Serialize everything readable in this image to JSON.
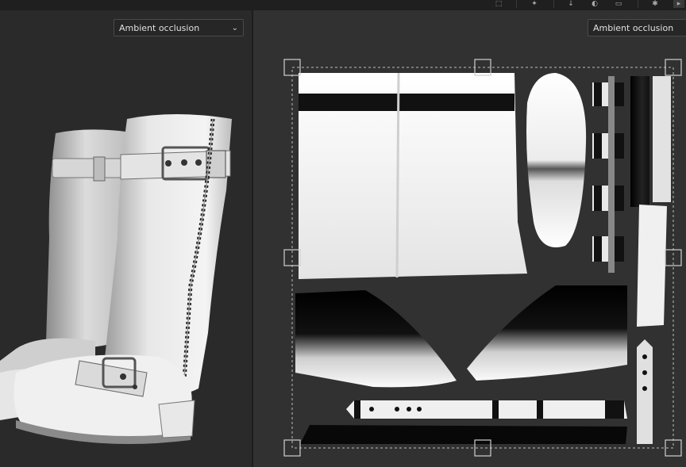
{
  "toolbar": {
    "icons": [
      "frame-icon",
      "gizmo-icon",
      "light-icon",
      "sphere-icon",
      "camera-icon",
      "settings-icon"
    ]
  },
  "left_view": {
    "channel_dropdown": {
      "label": "Ambient occlusion"
    },
    "content": "3d-boot-model"
  },
  "right_view": {
    "channel_dropdown": {
      "label": "Ambient occlusion"
    },
    "content": "uv-texture-map"
  },
  "colors": {
    "panel_bg": "#2a2a2a",
    "uv_bg": "#313131",
    "dropdown_bg": "#262626",
    "text": "#e0e0e0"
  }
}
